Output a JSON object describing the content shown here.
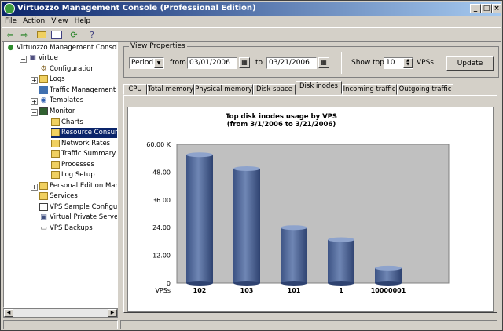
{
  "window": {
    "title": "Virtuozzo Management Console (Professional Edition)"
  },
  "menu": [
    "File",
    "Action",
    "View",
    "Help"
  ],
  "tree": {
    "root": "Virtuozzo Management Console",
    "host": "virtue",
    "items": [
      "Configuration",
      "Logs",
      "Traffic Management",
      "Templates",
      "Monitor"
    ],
    "monitor_children": [
      "Charts",
      "Resource Consumin",
      "Network Rates",
      "Traffic Summary",
      "Processes",
      "Log Setup"
    ],
    "more": [
      "Personal Edition Manage",
      "Services",
      "VPS Sample Configuratic",
      "Virtual Private Servers",
      "VPS Backups"
    ]
  },
  "view_properties": {
    "legend": "View Properties",
    "mode": "Period",
    "from_label": "from",
    "from_date": "03/01/2006",
    "to_label": "to",
    "to_date": "03/21/2006",
    "show_top_label": "Show top",
    "show_top_value": "10",
    "vps_label": "VPSs",
    "update_label": "Update"
  },
  "tabs": [
    "CPU",
    "Total memory",
    "Physical memory",
    "Disk space",
    "Disk inodes",
    "Incoming traffic",
    "Outgoing traffic"
  ],
  "active_tab": "Disk inodes",
  "chart_data": {
    "type": "bar",
    "title": "Top disk inodes usage by VPS",
    "subtitle": "(from 3/1/2006 to 3/21/2006)",
    "xlabel": "VPSs",
    "ylabel": "",
    "categories": [
      "102",
      "103",
      "101",
      "1",
      "10000001"
    ],
    "values": [
      55.5,
      49.5,
      24.0,
      18.8,
      6.5
    ],
    "ylim": [
      0,
      60
    ],
    "yticks": [
      "0",
      "12.00",
      "24.00",
      "36.00",
      "48.00",
      "60.00 K"
    ],
    "grid": false,
    "bar_color": "#6f86b4"
  }
}
